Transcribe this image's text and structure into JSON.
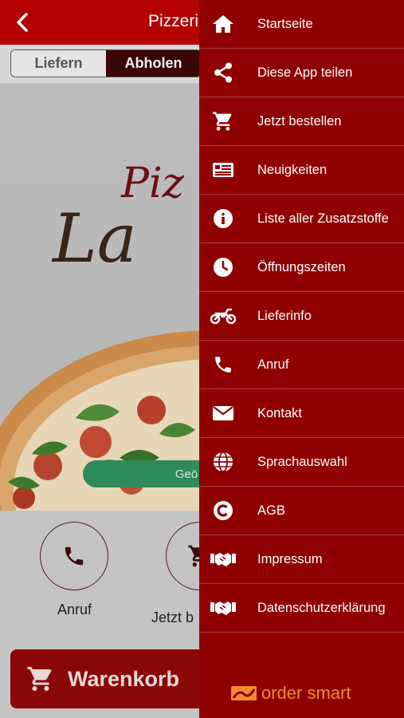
{
  "header": {
    "back_icon": "chevron-left-icon",
    "title": "Pizzeria"
  },
  "order_mode": {
    "options": [
      "Liefern",
      "Abholen"
    ],
    "selected": "Abholen"
  },
  "hero": {
    "logo_line1": "Piz",
    "logo_line2": "La",
    "hours_badge": "Geö"
  },
  "actions": [
    {
      "label": "Anruf",
      "icon": "phone-icon"
    },
    {
      "label": "Jetzt b",
      "icon": "cart-icon"
    }
  ],
  "cart_button": {
    "label": "Warenkorb",
    "icon": "cart-icon"
  },
  "drawer": {
    "items": [
      {
        "label": "Startseite",
        "icon": "home-icon"
      },
      {
        "label": "Diese App teilen",
        "icon": "share-icon"
      },
      {
        "label": "Jetzt bestellen",
        "icon": "cart-icon"
      },
      {
        "label": "Neuigkeiten",
        "icon": "newspaper-icon"
      },
      {
        "label": "Liste aller Zusatzstoffe",
        "icon": "info-icon"
      },
      {
        "label": "Öffnungszeiten",
        "icon": "clock-icon"
      },
      {
        "label": "Lieferinfo",
        "icon": "motorcycle-icon"
      },
      {
        "label": "Anruf",
        "icon": "phone-icon"
      },
      {
        "label": "Kontakt",
        "icon": "envelope-icon"
      },
      {
        "label": "Sprachauswahl",
        "icon": "globe-icon"
      },
      {
        "label": "AGB",
        "icon": "copyright-icon"
      },
      {
        "label": "Impressum",
        "icon": "handshake-icon"
      },
      {
        "label": "Datenschutzerklärung",
        "icon": "handshake-icon"
      }
    ],
    "brand": "order smart"
  },
  "colors": {
    "topbar": "#b40000",
    "drawer": "#8f0101",
    "cart_button": "#8a0707",
    "hours_badge": "#2e8a5c",
    "brand": "#f08a2e"
  }
}
